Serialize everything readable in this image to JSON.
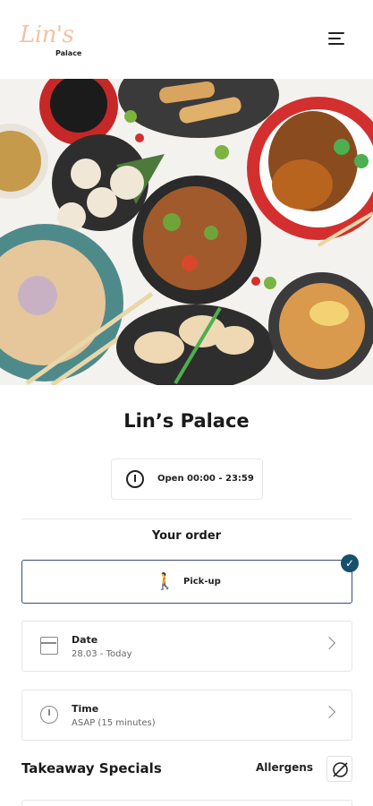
{
  "header": {
    "logo_script": "Lin's",
    "logo_sub": "Palace",
    "menu_icon": "hamburger-menu-icon"
  },
  "hero": {
    "image": "asian-food-spread"
  },
  "restaurant": {
    "name": "Lin’s Palace",
    "hours": "Open 00:00 - 23:59"
  },
  "order": {
    "heading": "Your order",
    "mode_label": "Pick-up",
    "mode_selected": true,
    "date": {
      "label": "Date",
      "value": "28.03 - Today"
    },
    "time": {
      "label": "Time",
      "value": "ASAP (15 minutes)"
    }
  },
  "specials": {
    "heading": "Takeaway Specials",
    "allergens_label": "Allergens"
  },
  "colors": {
    "accent": "#16506b",
    "logo": "#f4c3a3",
    "pickup_border": "#3d4a75"
  }
}
